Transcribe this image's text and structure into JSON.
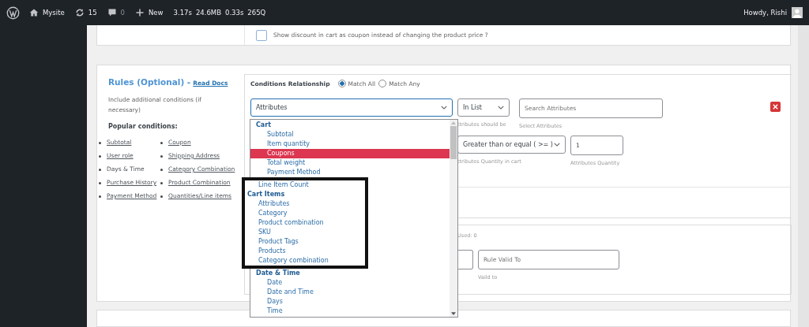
{
  "admin_bar": {
    "site": "Mysite",
    "updates": "15",
    "comments": "0",
    "new": "New",
    "stats": [
      "3.17s",
      "24.6MB",
      "0.33s",
      "265Q"
    ],
    "greeting": "Howdy, Rishi"
  },
  "coupon_option": {
    "label": "Show discount in cart as coupon instead of changing the product price ?",
    "checked": false
  },
  "rules": {
    "title": "Rules (Optional) -",
    "docs_link": "Read Docs",
    "description": "Include additional conditions (if necessary)",
    "popular_heading": "Popular conditions:",
    "popular_columns": [
      [
        {
          "label": "Subtotal",
          "link": true
        },
        {
          "label": "User role",
          "link": true
        },
        {
          "label": "Days & Time",
          "link": false
        },
        {
          "label": "Purchase History",
          "link": true
        },
        {
          "label": "Payment Method",
          "link": true
        }
      ],
      [
        {
          "label": "Coupon",
          "link": true
        },
        {
          "label": "Shipping Address",
          "link": true
        },
        {
          "label": "Category Combination",
          "link": true
        },
        {
          "label": "Product Combination",
          "link": true
        },
        {
          "label": "Quantities/Line items",
          "link": true
        }
      ]
    ]
  },
  "conditions": {
    "relationship_label": "Conditions Relationship",
    "options": [
      {
        "label": "Match All",
        "selected": true
      },
      {
        "label": "Match Any",
        "selected": false
      }
    ],
    "type_select": {
      "value": "Attributes"
    },
    "operator_select": {
      "value": "In List",
      "caption": "ttributes should be"
    },
    "search": {
      "placeholder": "Search Attributes",
      "caption": "Select Attributes"
    },
    "quantity_operator": {
      "value": "Greater than or equal ( >= )",
      "caption": "ttributes Quantity in cart"
    },
    "quantity": {
      "value": "1",
      "caption": "Attributes Quantity"
    }
  },
  "dropdown": {
    "groups": [
      {
        "label": "Cart",
        "boxed": false,
        "options": [
          {
            "label": "Subtotal",
            "selected": false,
            "boxed": false
          },
          {
            "label": "Item quantity",
            "selected": false,
            "boxed": false
          },
          {
            "label": "Coupons",
            "selected": true,
            "boxed": false
          },
          {
            "label": "Total weight",
            "selected": false,
            "boxed": false
          },
          {
            "label": "Payment Method",
            "selected": false,
            "boxed": false
          },
          {
            "label": "Line Item Count",
            "selected": false,
            "boxed": true
          }
        ]
      },
      {
        "label": "Cart Items",
        "boxed": true,
        "options": [
          {
            "label": "Attributes",
            "selected": false,
            "boxed": true
          },
          {
            "label": "Category",
            "selected": false,
            "boxed": true
          },
          {
            "label": "Product combination",
            "selected": false,
            "boxed": true
          },
          {
            "label": "SKU",
            "selected": false,
            "boxed": true
          },
          {
            "label": "Product Tags",
            "selected": false,
            "boxed": true
          },
          {
            "label": "Products",
            "selected": false,
            "boxed": true
          },
          {
            "label": "Category combination",
            "selected": false,
            "boxed": true
          }
        ]
      },
      {
        "label": "Date & Time",
        "boxed": false,
        "options": [
          {
            "label": "Date",
            "selected": false,
            "boxed": false
          },
          {
            "label": "Date and Time",
            "selected": false,
            "boxed": false
          },
          {
            "label": "Days",
            "selected": false,
            "boxed": false
          },
          {
            "label": "Time",
            "selected": false,
            "boxed": false
          }
        ]
      }
    ]
  },
  "usage": {
    "used": "Used: 0",
    "valid_to": {
      "placeholder": "Rule Valid To",
      "caption": "Vaild to"
    }
  }
}
